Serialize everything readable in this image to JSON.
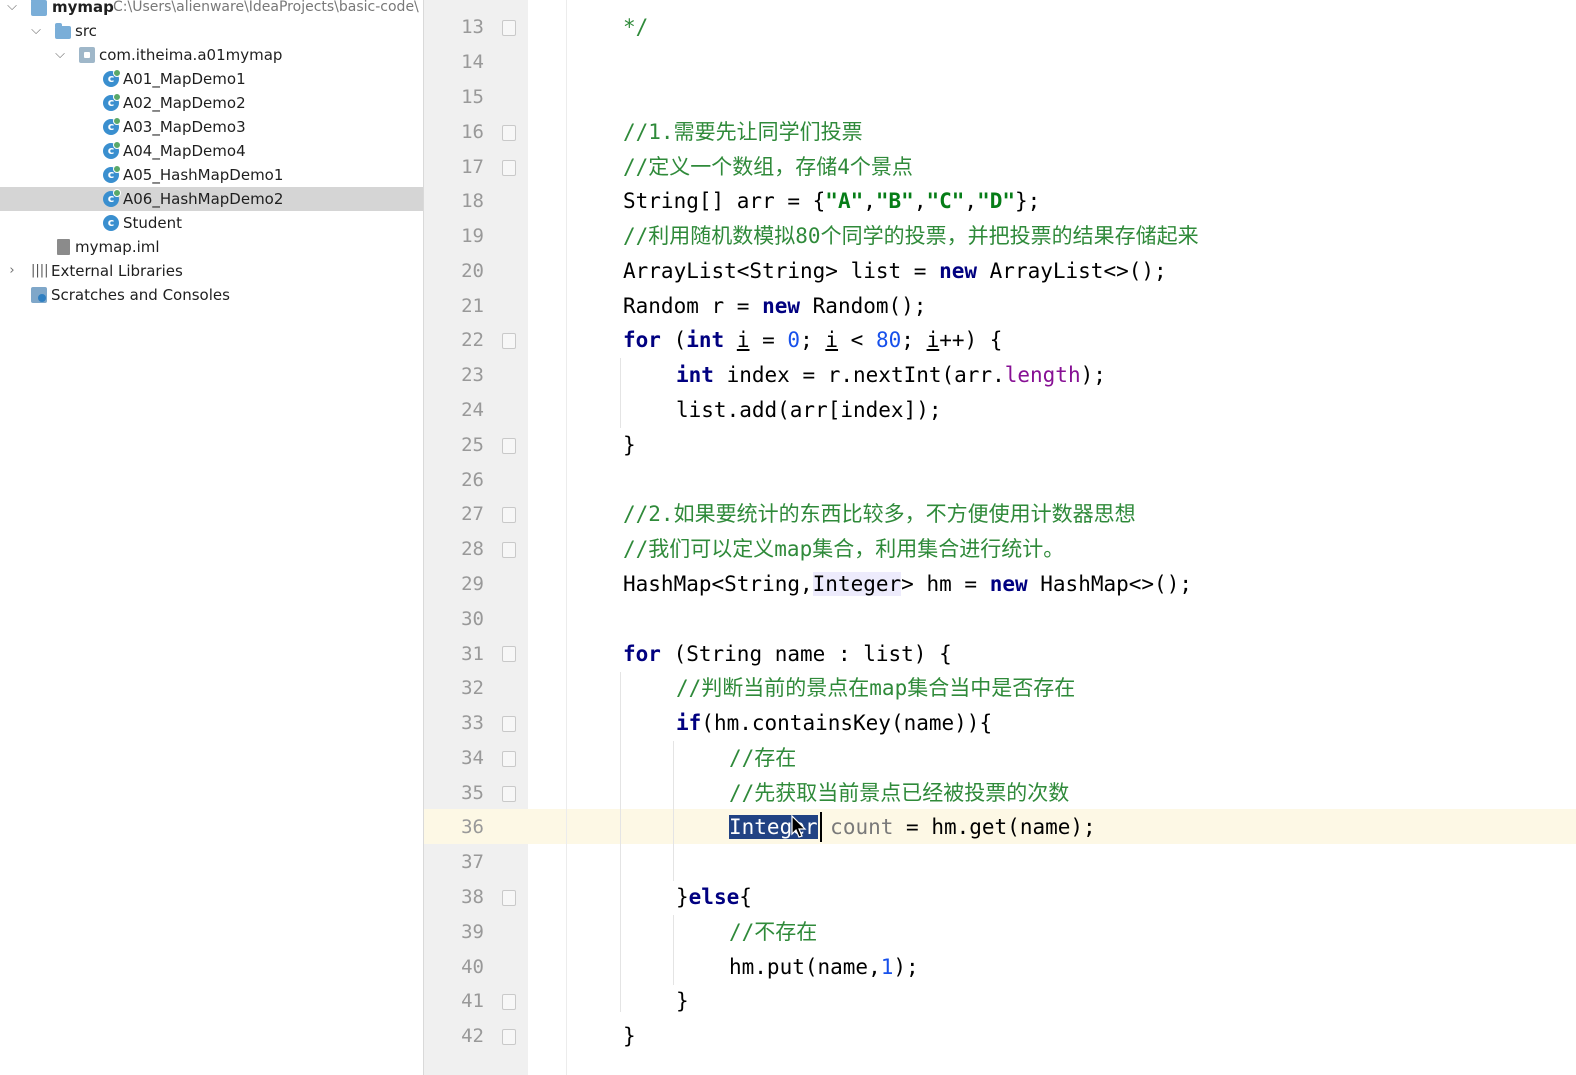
{
  "project_tree": {
    "root": {
      "name": "mymap",
      "path": "C:\\Users\\alienware\\IdeaProjects\\basic-code\\"
    },
    "items": [
      {
        "label": "src",
        "type": "folder"
      },
      {
        "label": "com.itheima.a01mymap",
        "type": "package"
      },
      {
        "label": "A01_MapDemo1",
        "type": "class"
      },
      {
        "label": "A02_MapDemo2",
        "type": "class"
      },
      {
        "label": "A03_MapDemo3",
        "type": "class"
      },
      {
        "label": "A04_MapDemo4",
        "type": "class"
      },
      {
        "label": "A05_HashMapDemo1",
        "type": "class"
      },
      {
        "label": "A06_HashMapDemo2",
        "type": "class",
        "selected": true
      },
      {
        "label": "Student",
        "type": "class"
      },
      {
        "label": "mymap.iml",
        "type": "file"
      },
      {
        "label": "External Libraries",
        "type": "libraries"
      },
      {
        "label": "Scratches and Consoles",
        "type": "scratches"
      }
    ]
  },
  "editor": {
    "current_line": 36,
    "lines": [
      {
        "n": "13",
        "text": "*/"
      },
      {
        "n": "14",
        "text": ""
      },
      {
        "n": "15",
        "text": ""
      },
      {
        "n": "16",
        "text": "//1.需要先让同学们投票"
      },
      {
        "n": "17",
        "text": "//定义一个数组，存储4个景点"
      },
      {
        "n": "18",
        "parts": [
          "String[] arr = {",
          "\"A\"",
          ",",
          "\"B\"",
          ",",
          "\"C\"",
          ",",
          "\"D\"",
          "};"
        ]
      },
      {
        "n": "19",
        "text": "//利用随机数模拟80个同学的投票，并把投票的结果存储起来"
      },
      {
        "n": "20",
        "parts": [
          "ArrayList<String> list = ",
          "new",
          " ArrayList<>();"
        ]
      },
      {
        "n": "21",
        "parts": [
          "Random r = ",
          "new",
          " Random();"
        ]
      },
      {
        "n": "22",
        "parts": [
          "for",
          " (",
          "int",
          " ",
          "i",
          " = ",
          "0",
          "; ",
          "i",
          " < ",
          "80",
          "; ",
          "i",
          "++) {"
        ]
      },
      {
        "n": "23",
        "parts": [
          "int",
          " index = r.nextInt(arr.",
          "length",
          ");"
        ]
      },
      {
        "n": "24",
        "text": "list.add(arr[index]);"
      },
      {
        "n": "25",
        "text": "}"
      },
      {
        "n": "26",
        "text": ""
      },
      {
        "n": "27",
        "text": "//2.如果要统计的东西比较多，不方便使用计数器思想"
      },
      {
        "n": "28",
        "text": "//我们可以定义map集合，利用集合进行统计。"
      },
      {
        "n": "29",
        "parts": [
          "HashMap<String,",
          "Integer",
          "> hm = ",
          "new",
          " HashMap<>();"
        ]
      },
      {
        "n": "30",
        "text": ""
      },
      {
        "n": "31",
        "parts": [
          "for",
          " (String name : list) {"
        ]
      },
      {
        "n": "32",
        "text": "//判断当前的景点在map集合当中是否存在"
      },
      {
        "n": "33",
        "parts": [
          "if",
          "(hm.containsKey(name)){"
        ]
      },
      {
        "n": "34",
        "text": "//存在"
      },
      {
        "n": "35",
        "text": "//先获取当前景点已经被投票的次数"
      },
      {
        "n": "36",
        "parts": [
          "Integer",
          " ",
          "count",
          " = hm.get(name);"
        ]
      },
      {
        "n": "37",
        "text": ""
      },
      {
        "n": "38",
        "parts": [
          "}",
          "else",
          "{"
        ]
      },
      {
        "n": "39",
        "text": "//不存在"
      },
      {
        "n": "40",
        "parts": [
          "hm.put(name,",
          "1",
          ");"
        ]
      },
      {
        "n": "41",
        "text": "}"
      },
      {
        "n": "42",
        "text": "}"
      }
    ]
  },
  "colors": {
    "comment": "#2f8a3a",
    "keyword": "#000080",
    "number": "#1750eb",
    "string": "#067d17",
    "field": "#871094",
    "selection": "#214283",
    "caret_line": "#fdf8e5",
    "gutter": "#f0f0f0"
  },
  "icons": {
    "expand": "chevron-down-icon",
    "collapse": "chevron-right-icon",
    "folder": "folder-icon",
    "package": "package-icon",
    "class": "java-class-icon",
    "module_file": "iml-file-icon",
    "libraries": "library-icon",
    "scratches": "scratches-icon",
    "mouse": "mouse-pointer-icon"
  }
}
